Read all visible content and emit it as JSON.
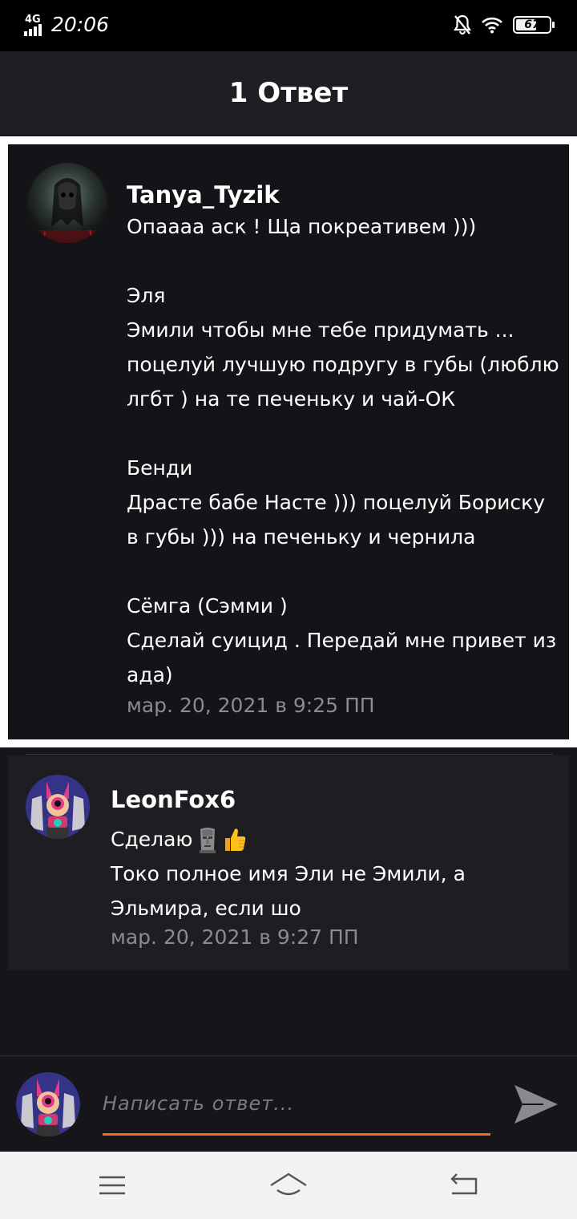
{
  "status_bar": {
    "network": "4G",
    "time": "20:06",
    "battery": "67",
    "battery_level": 0.67
  },
  "header": {
    "title": "1 Ответ"
  },
  "comments": [
    {
      "author": "Tanya_Tyzik",
      "lines": [
        "Опаааа аск ! Ща покреативем )))",
        "",
        "Эля",
        "Эмили чтобы мне тебе придумать ...",
        "поцелуй лучшую подругу в губы (люблю",
        "лгбт ) на те печеньку и чай-ОК",
        "",
        "Бенди",
        "Дрaсте бабе Насте ))) поцелуй Бориску",
        "в губы ))) на печеньку и чернила",
        "",
        "Сёмга (Сэмми )",
        "Сделай суицид . Передай мне привет из",
        "ада)"
      ],
      "time": "мар. 20, 2021 в 9:25 ПП"
    },
    {
      "author": "LeonFox6",
      "lines": [
        "Сделаю",
        "Токо полное имя Эли не Эмили, а",
        "Эльмира, если шо"
      ],
      "emoji": [
        "moai-icon",
        "thumbs-up-icon"
      ],
      "time": "мар. 20, 2021 в 9:27 ПП"
    }
  ],
  "composer": {
    "placeholder": "Написать ответ..."
  },
  "nav": {
    "icons": [
      "menu-icon",
      "home-icon",
      "back-icon"
    ]
  },
  "colors": {
    "accent": "#f26a2a",
    "background": "#161519",
    "header": "#1f1e22"
  }
}
